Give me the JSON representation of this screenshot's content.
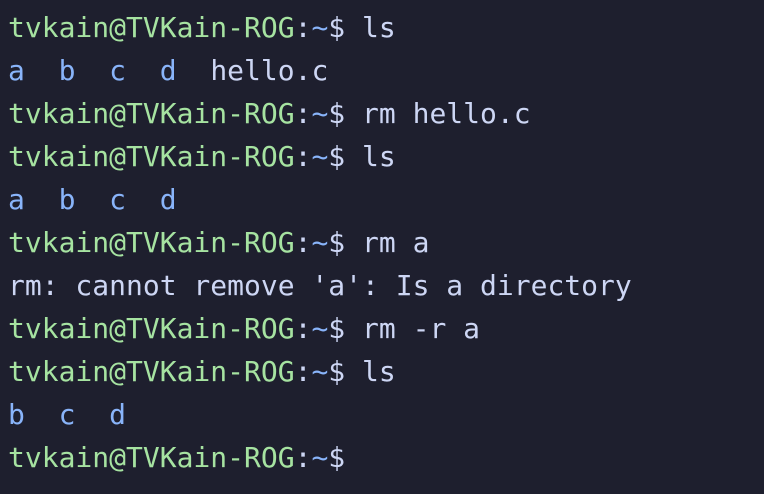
{
  "prompt": {
    "user_host": "tvkain@TVKain-ROG",
    "separator": ":",
    "path": "~",
    "symbol": "$"
  },
  "lines": [
    {
      "type": "cmd",
      "command": " ls"
    },
    {
      "type": "listing",
      "entries": [
        {
          "name": "a",
          "kind": "dir"
        },
        {
          "name": "b",
          "kind": "dir"
        },
        {
          "name": "c",
          "kind": "dir"
        },
        {
          "name": "d",
          "kind": "dir"
        },
        {
          "name": "hello.c",
          "kind": "file"
        }
      ]
    },
    {
      "type": "cmd",
      "command": " rm hello.c"
    },
    {
      "type": "cmd",
      "command": " ls"
    },
    {
      "type": "listing",
      "entries": [
        {
          "name": "a",
          "kind": "dir"
        },
        {
          "name": "b",
          "kind": "dir"
        },
        {
          "name": "c",
          "kind": "dir"
        },
        {
          "name": "d",
          "kind": "dir"
        }
      ]
    },
    {
      "type": "cmd",
      "command": " rm a"
    },
    {
      "type": "output",
      "text": "rm: cannot remove 'a': Is a directory"
    },
    {
      "type": "cmd",
      "command": " rm -r a"
    },
    {
      "type": "cmd",
      "command": " ls"
    },
    {
      "type": "listing",
      "entries": [
        {
          "name": "b",
          "kind": "dir"
        },
        {
          "name": "c",
          "kind": "dir"
        },
        {
          "name": "d",
          "kind": "dir"
        }
      ]
    },
    {
      "type": "cmd",
      "command": ""
    }
  ],
  "colors": {
    "background": "#1e1f2e",
    "prompt_user": "#a6e3a1",
    "prompt_path": "#89b4fa",
    "directory": "#89b4fa",
    "text": "#cdd6f4"
  }
}
